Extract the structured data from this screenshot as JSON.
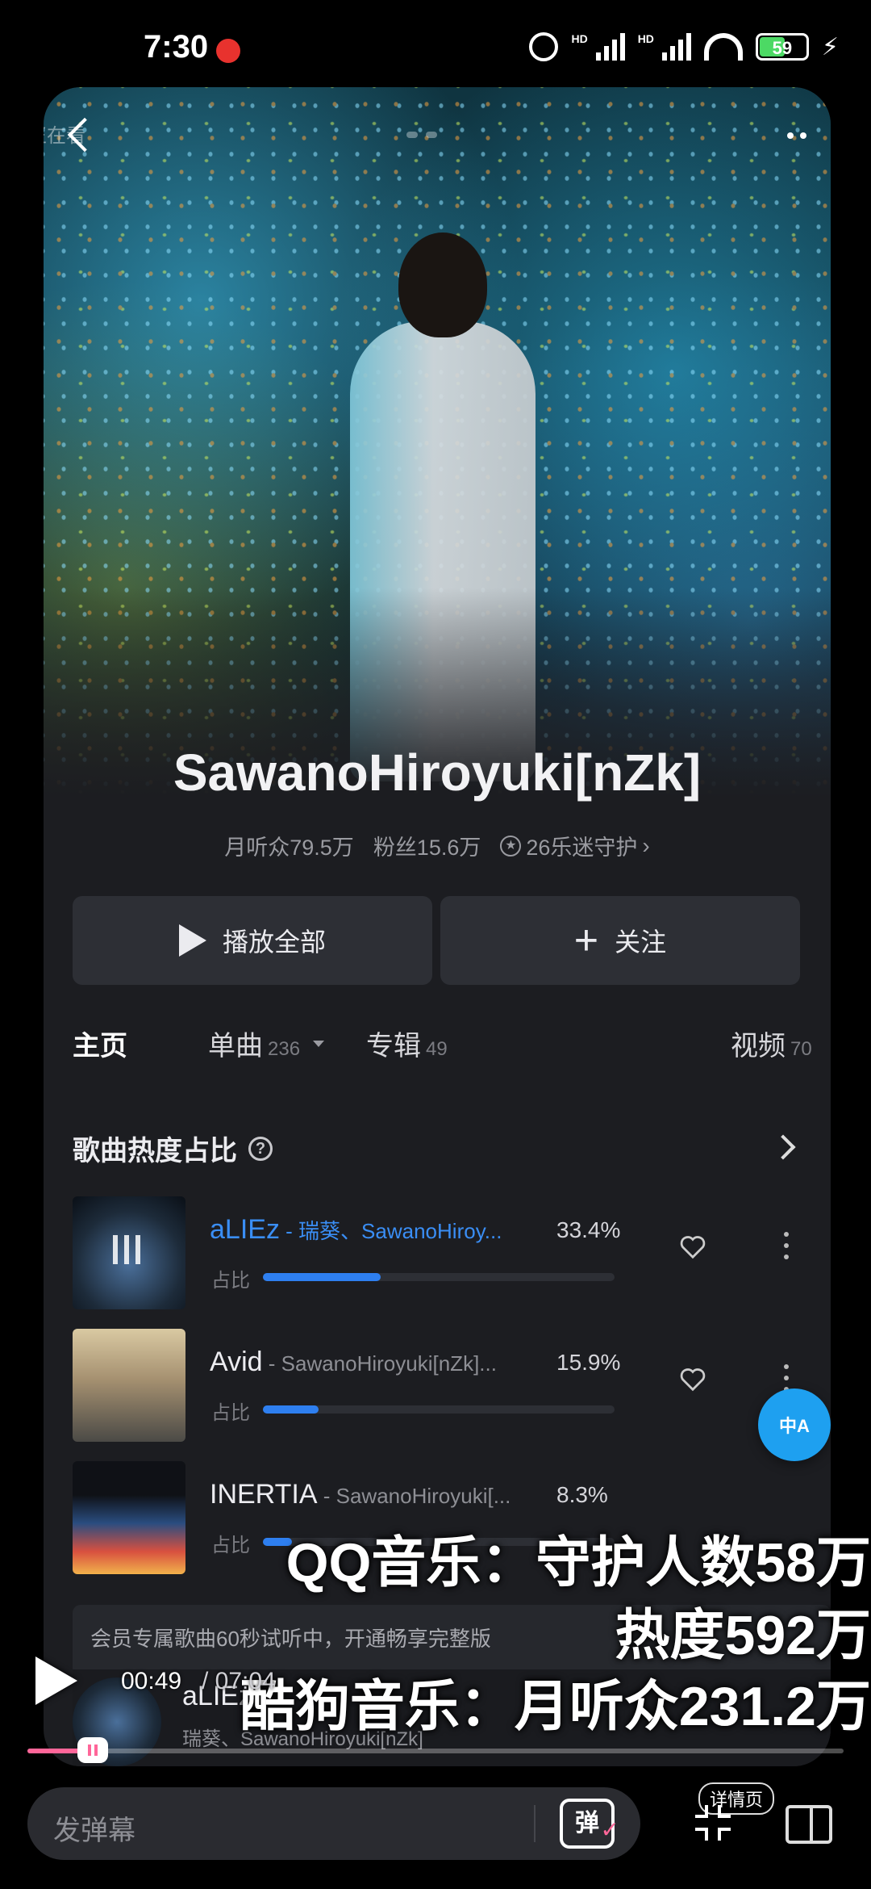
{
  "status": {
    "time": "7:30",
    "battery_level": "59",
    "hd1": "HD",
    "hd2": "HD"
  },
  "header": {
    "watching_label": "正在看"
  },
  "artist": {
    "name": "SawanoHiroyuki[nZk]",
    "monthly_listeners": "月听众79.5万",
    "fans": "粉丝15.6万",
    "guardians": "26乐迷守护"
  },
  "actions": {
    "play_all": "播放全部",
    "follow": "关注"
  },
  "tabs": [
    {
      "label": "主页",
      "count": ""
    },
    {
      "label": "单曲",
      "count": "236"
    },
    {
      "label": "专辑",
      "count": "49"
    },
    {
      "label": "视频",
      "count": "70"
    }
  ],
  "section": {
    "title": "歌曲热度占比",
    "help": "?"
  },
  "share_label": "占比",
  "songs": [
    {
      "title": "aLIEz",
      "artist": " - 瑞葵、SawanoHiroy...",
      "percent": "33.4%",
      "share": 0.334
    },
    {
      "title": "Avid",
      "artist": " - SawanoHiroyuki[nZk]...",
      "percent": "15.9%",
      "share": 0.159
    },
    {
      "title": "INERTIA",
      "artist": " - SawanoHiroyuki[...",
      "percent": "8.3%",
      "share": 0.083
    }
  ],
  "translate_label": "中A",
  "vip_notice": "会员专属歌曲60秒试听中，开通畅享完整版",
  "mini_player": {
    "title": "aLIEz",
    "artist": "瑞葵、SawanoHiroyuki[nZk]"
  },
  "overlay_text": [
    "QQ音乐：守护人数58万",
    "热度592万",
    "酷狗音乐：月听众231.2万"
  ],
  "video": {
    "current_time": "00:49",
    "total_time": "/ 07:04",
    "progress": 0.065
  },
  "bottom": {
    "danmaku_placeholder": "发弹幕",
    "danmaku_toggle": "弹",
    "detail_label": "详情页"
  },
  "colors": {
    "accent_blue": "#2e7ff0",
    "progress_pink": "#ff6699",
    "translate_button": "#1ea0f0"
  }
}
